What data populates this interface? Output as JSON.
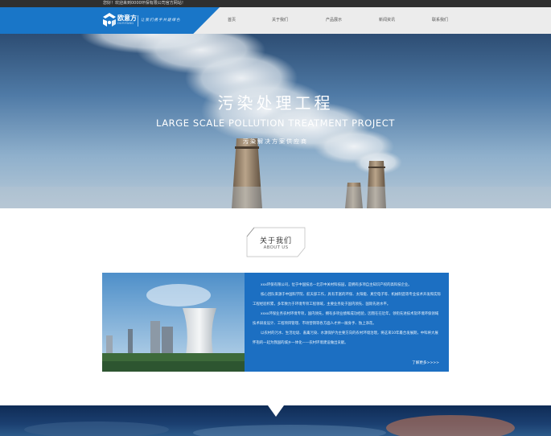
{
  "topbar": {
    "text": "您好！欢迎来到0000环保有限公司官方网站！"
  },
  "logo": {
    "name": "欧意方",
    "sub": "OUYIFANG",
    "slogan": "让我们携手共建绿色"
  },
  "nav": {
    "items": [
      "首页",
      "关于我们",
      "产品展示",
      "新闻资讯",
      "联系我们"
    ]
  },
  "hero": {
    "title": "污染处理工程",
    "subtitle_en": "LARGE SCALE POLLUTION TREATMENT PROJECT",
    "tagline": "污染解决方案供应商"
  },
  "about": {
    "heading_cn": "关于我们",
    "heading_en": "ABOUT US",
    "paragraphs": [
      "xxx环保有限公司，位于中国技总—北京中关村科技园，是拥有多项自主知识产权的高科技企业。",
      "核心团队来源于中国科学院、航天部工作，具有丰富的环保、太阳能、真空电子等、机械制造等专业技术开发和实际工程经验积累，多年致力于环境专项工程领域，主要业务处于国内领先、国际先进水平。",
      "xxxx环保业务农村环境专项，国内领先，拥有多项业绩和成功经验，因而在在近年，领衔先进技术及环境环保领域技术研发设计、工程项目管理、市场营销等各方面人才并一展身手、独上添花。",
      "以农村的污水、生活垃圾、畜禽污染、水源保护为主要方向的农村环境治理，将这来10年最合发展期，中科将大展怀抱的一起为我国的城乡一体化——农村环境建设做出贡献。"
    ],
    "more_label": "了解更多>>>>"
  }
}
